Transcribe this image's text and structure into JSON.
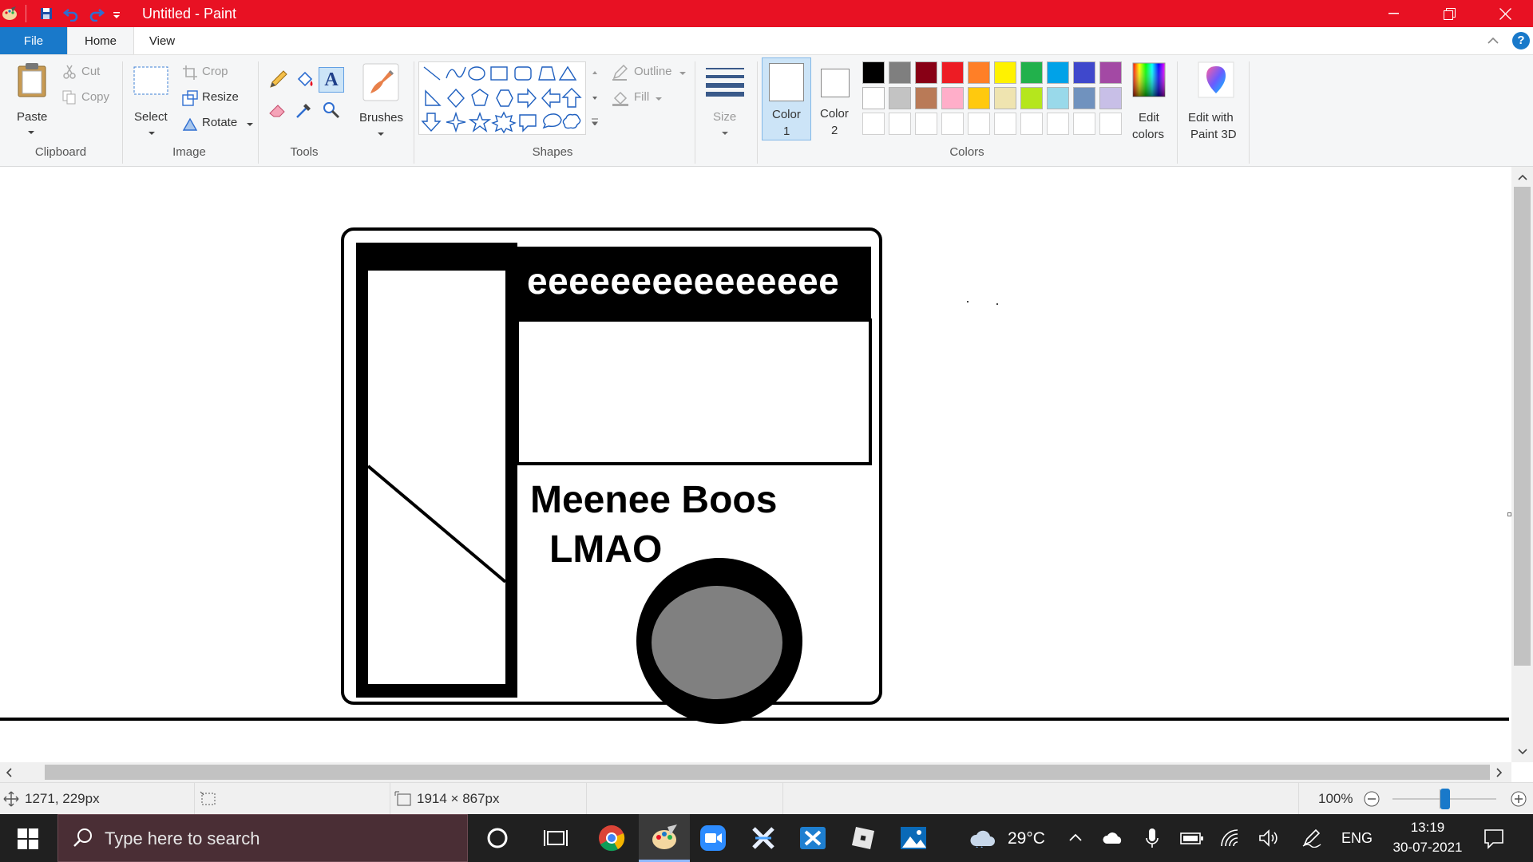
{
  "window": {
    "title": "Untitled - Paint"
  },
  "tabs": {
    "file": "File",
    "home": "Home",
    "view": "View"
  },
  "ribbon": {
    "clipboard": {
      "label": "Clipboard",
      "paste": "Paste",
      "cut": "Cut",
      "copy": "Copy"
    },
    "image": {
      "label": "Image",
      "select": "Select",
      "crop": "Crop",
      "resize": "Resize",
      "rotate": "Rotate"
    },
    "tools": {
      "label": "Tools",
      "brushes": "Brushes"
    },
    "shapes": {
      "label": "Shapes",
      "outline": "Outline",
      "fill": "Fill"
    },
    "size": {
      "label": "Size"
    },
    "colors": {
      "label": "Colors",
      "color1_line1": "Color",
      "color1_line2": "1",
      "color2_line1": "Color",
      "color2_line2": "2",
      "edit_line1": "Edit",
      "edit_line2": "colors",
      "paint3d_line1": "Edit with",
      "paint3d_line2": "Paint 3D",
      "palette_row1": [
        "#000000",
        "#7f7f7f",
        "#880015",
        "#ed1c24",
        "#ff7f27",
        "#fff200",
        "#22b14c",
        "#00a2e8",
        "#3f48cc",
        "#a349a4"
      ],
      "palette_row2": [
        "#ffffff",
        "#c3c3c3",
        "#b97a57",
        "#ffaec9",
        "#ffc90e",
        "#efe4b0",
        "#b5e61d",
        "#99d9ea",
        "#7092be",
        "#c8bfe7"
      ]
    }
  },
  "canvas": {
    "banner_text": "eeeeeeeeeeeeeee",
    "line1": "Meenee Boos",
    "line2": "LMAO"
  },
  "status": {
    "cursor": "1271, 229px",
    "canvas_size": "1914 × 867px",
    "zoom": "100%"
  },
  "taskbar": {
    "search_placeholder": "Type here to search",
    "weather": "29°C",
    "language": "ENG",
    "time": "13:19",
    "date": "30-07-2021"
  }
}
